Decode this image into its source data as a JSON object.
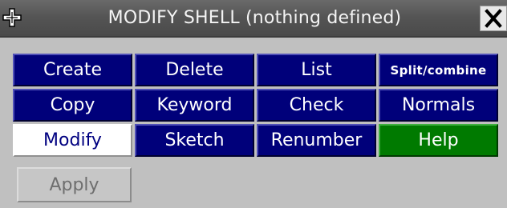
{
  "window": {
    "title": "MODIFY SHELL (nothing defined)",
    "move_icon": "move-cross-icon",
    "close_icon": "close-x-icon"
  },
  "buttons": {
    "create": "Create",
    "delete": "Delete",
    "list": "List",
    "split_combine": "Split/combine",
    "copy": "Copy",
    "keyword": "Keyword",
    "check": "Check",
    "normals": "Normals",
    "modify": "Modify",
    "sketch": "Sketch",
    "renumber": "Renumber",
    "help": "Help"
  },
  "active_button": "Modify",
  "apply": {
    "label": "Apply",
    "enabled": false
  },
  "colors": {
    "button_blue": "#00007a",
    "help_green": "#007a00",
    "active_white": "#ffffff",
    "panel_grey": "#c0c0c0",
    "titlebar": "#555555"
  }
}
